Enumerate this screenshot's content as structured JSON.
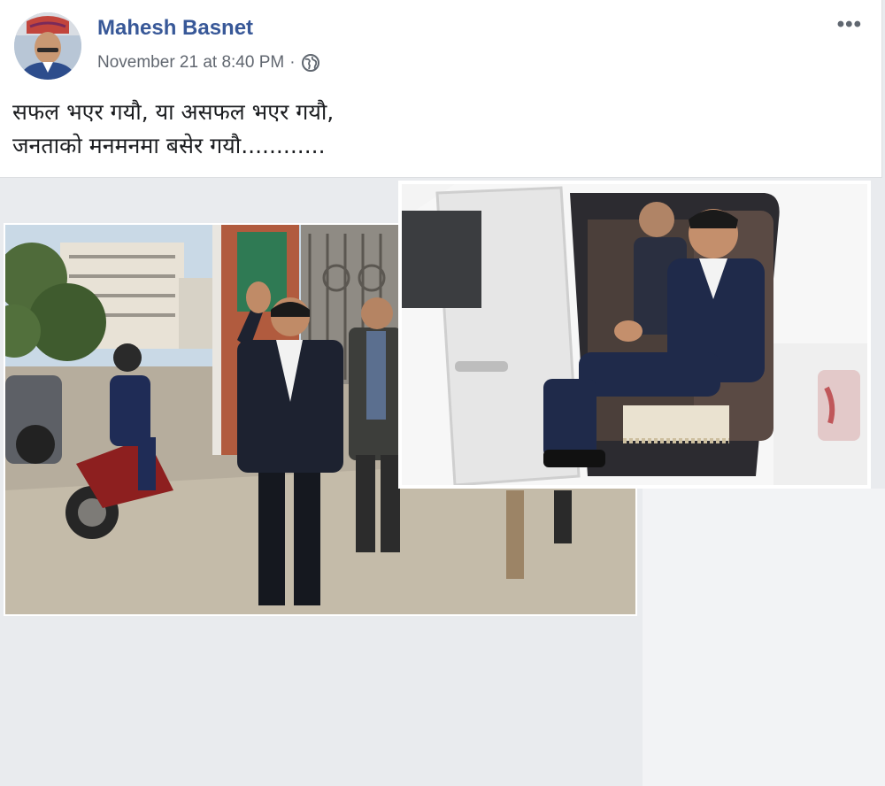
{
  "post": {
    "author": "Mahesh Basnet",
    "timestamp": "November 21 at 8:40 PM",
    "separator": "·",
    "privacy_icon": "globe-icon",
    "more_label": "•••",
    "text_line1": "सफल भएर गयौ, या असफल भएर गयौ,",
    "text_line2": "जनताको मनमनमा बसेर गयौ............"
  },
  "colors": {
    "author_link": "#385898",
    "meta_gray": "#616770",
    "feed_background": "#e9ebee"
  }
}
